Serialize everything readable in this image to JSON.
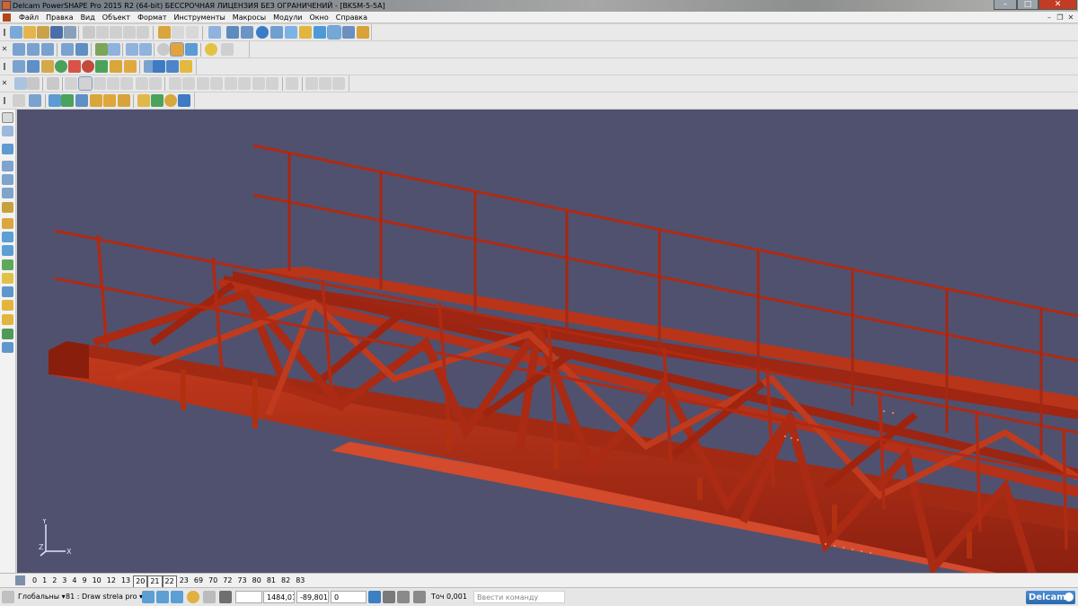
{
  "window": {
    "title": "Delcam PowerSHAPE Pro 2015 R2 (64-bit) БЕССРОЧНАЯ ЛИЦЕНЗИЯ БЕЗ ОГРАНИЧЕНИЙ - [BKSM-5-5A]",
    "minimize": "–",
    "maximize": "□",
    "close": "✕"
  },
  "menu": {
    "items": [
      "Файл",
      "Правка",
      "Вид",
      "Объект",
      "Формат",
      "Инструменты",
      "Макросы",
      "Модули",
      "Окно",
      "Справка"
    ],
    "doc_minimize": "–",
    "doc_restore": "❐",
    "doc_close": "✕"
  },
  "toolbars": {
    "close_glyph": "✕",
    "grip_glyph": "‖"
  },
  "colors": {
    "viewport_bg": "#50516f",
    "structure_red": "#b02a13",
    "structure_dark": "#7d1a0a",
    "structure_light": "#d64a2c",
    "axis": "#dfe3ff"
  },
  "axes": {
    "x": "X",
    "y": "Y",
    "z": "Z"
  },
  "levels": {
    "items": [
      "0",
      "1",
      "2",
      "3",
      "4",
      "9",
      "10",
      "12",
      "13",
      "20",
      "21",
      "22",
      "23",
      "69",
      "70",
      "72",
      "73",
      "80",
      "81",
      "82",
      "83"
    ],
    "highlighted": [
      "20",
      "21",
      "22"
    ]
  },
  "status": {
    "coord_mode": "Глобальны",
    "level_select": "81 : Draw strela pro",
    "dropdown_glyph": "▾",
    "x_value": "1484,01",
    "y_value": "-89,801",
    "z_value": "0",
    "tolerance_label": "Точ",
    "tolerance_value": "0,001",
    "command_placeholder": "Ввести команду",
    "logo_text": "Delcam"
  }
}
